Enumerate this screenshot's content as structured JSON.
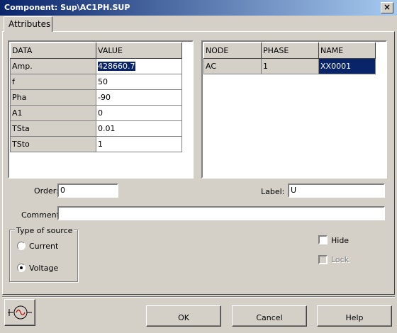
{
  "window": {
    "title": "Component: Sup\\AC1PH.SUP",
    "close_glyph": "×"
  },
  "tabs": [
    {
      "label": "Attributes"
    }
  ],
  "data_table": {
    "headers": [
      "DATA",
      "VALUE"
    ],
    "rows": [
      {
        "name": "Amp.",
        "value": "428660.7"
      },
      {
        "name": "f",
        "value": "50"
      },
      {
        "name": "Pha",
        "value": "-90"
      },
      {
        "name": "A1",
        "value": "0"
      },
      {
        "name": "TSta",
        "value": "0.01"
      },
      {
        "name": "TSto",
        "value": "1"
      }
    ]
  },
  "node_table": {
    "headers": [
      "NODE",
      "PHASE",
      "NAME"
    ],
    "rows": [
      {
        "node": "AC",
        "phase": "1",
        "name": "XX0001"
      }
    ]
  },
  "order": {
    "label": "Order:",
    "value": "0"
  },
  "label_field": {
    "label": "Label:",
    "value": "U"
  },
  "comment": {
    "label": "Comment:",
    "value": ""
  },
  "source_type": {
    "caption": "Type of source",
    "options": [
      {
        "label": "Current",
        "selected": false
      },
      {
        "label": "Voltage",
        "selected": true
      }
    ]
  },
  "checkboxes": {
    "hide": {
      "label": "Hide",
      "checked": false
    },
    "lock": {
      "label": "Lock",
      "checked": false,
      "disabled": true
    }
  },
  "buttons": {
    "ok": "OK",
    "cancel": "Cancel",
    "help": "Help"
  },
  "icons": {
    "component": "ac-source-icon"
  }
}
